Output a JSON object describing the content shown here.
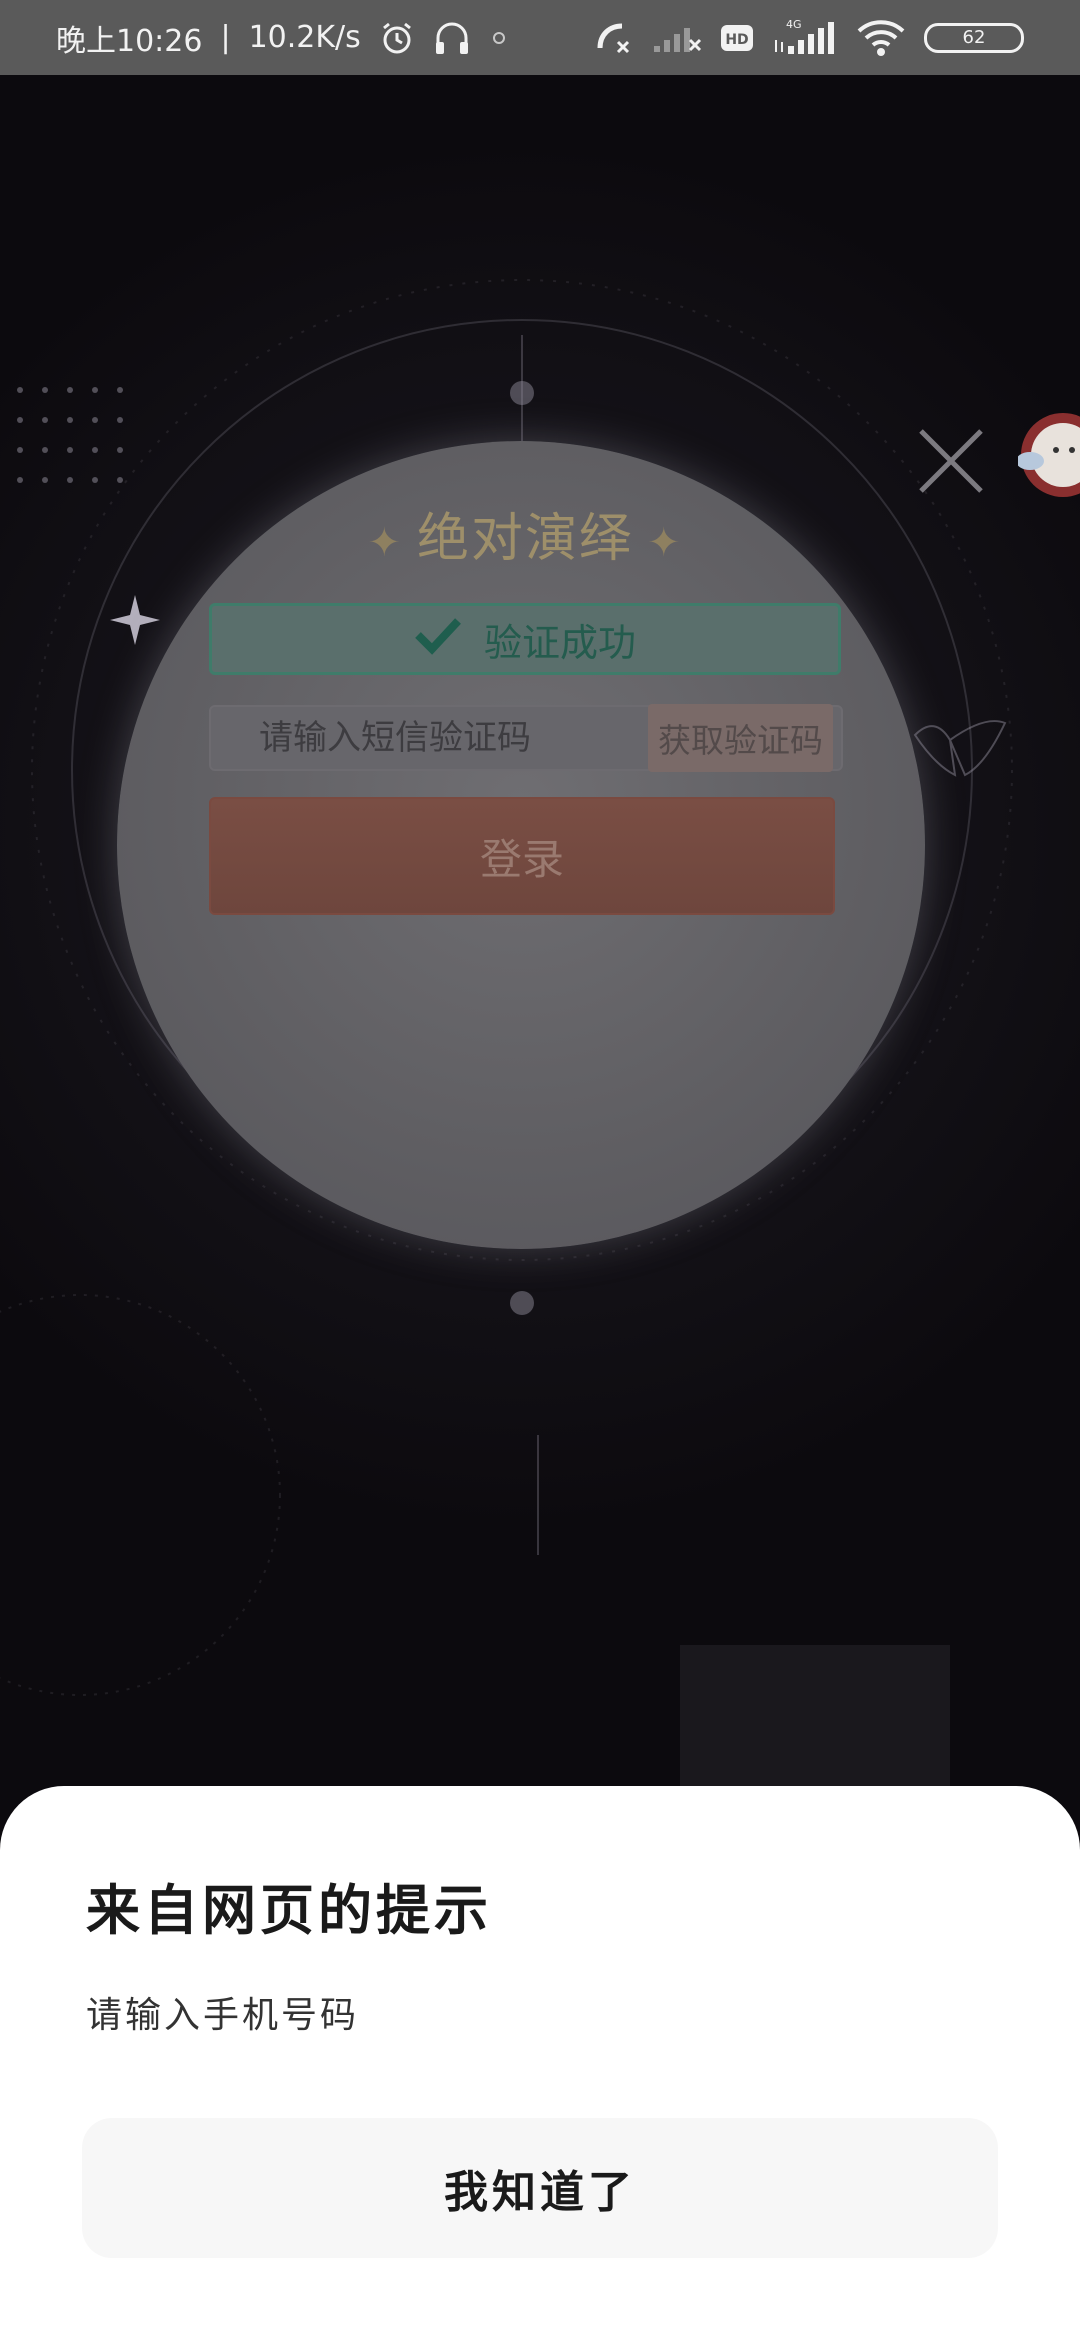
{
  "status_bar": {
    "time": "晚上10:26",
    "net_speed": "10.2K/s",
    "signal_label": "HD",
    "network_type": "4G",
    "battery": "62"
  },
  "login_page": {
    "title": "绝对演绎",
    "verify_status": "验证成功",
    "sms_placeholder": "请输入短信验证码",
    "get_code_label": "获取验证码",
    "login_label": "登录"
  },
  "dialog": {
    "title": "来自网页的提示",
    "message": "请输入手机号码",
    "confirm_label": "我知道了"
  }
}
